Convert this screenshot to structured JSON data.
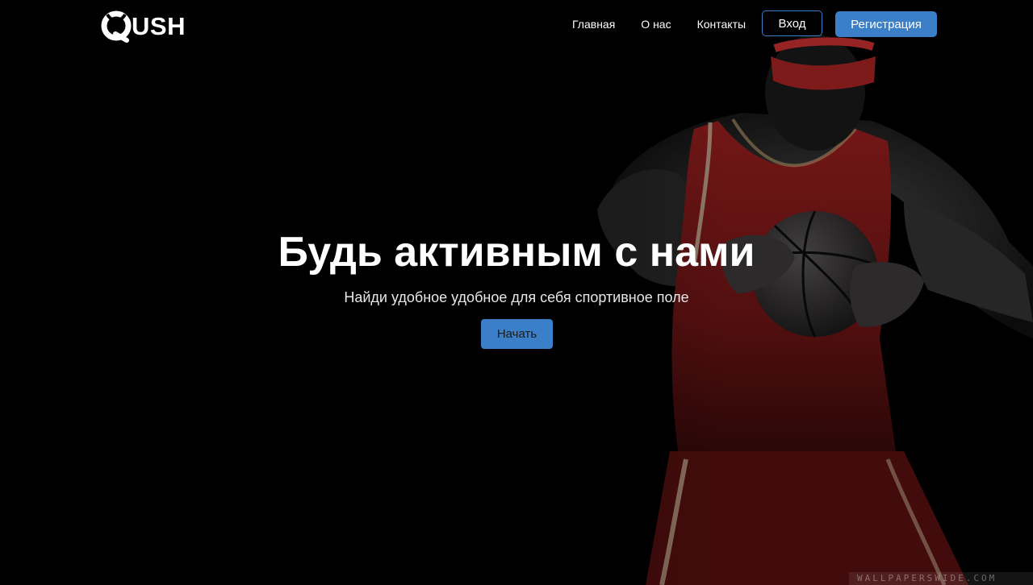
{
  "brand": {
    "logo_text": "USH"
  },
  "nav": {
    "items": [
      {
        "label": "Главная"
      },
      {
        "label": "О нас"
      },
      {
        "label": "Контакты"
      }
    ],
    "login_label": "Вход",
    "register_label": "Регистрация"
  },
  "hero": {
    "title": "Будь активным с нами",
    "subtitle": "Найди удобное удобное для себя спортивное поле",
    "cta_label": "Начать"
  },
  "watermark": {
    "text": "WALLPAPERSWIDE.COM"
  },
  "colors": {
    "background": "#000000",
    "accent": "#3a7fc7",
    "jersey_red": "#8e1a1a",
    "text": "#ffffff"
  },
  "icons": {
    "logo": "qush-logo-icon"
  }
}
